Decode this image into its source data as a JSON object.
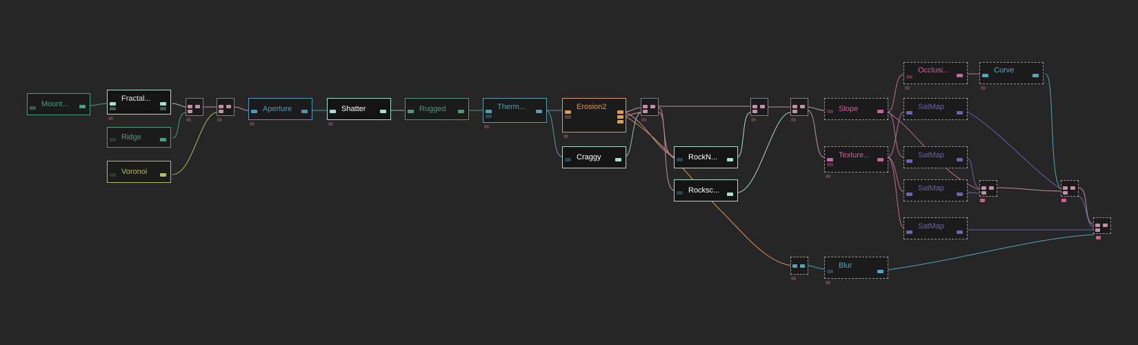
{
  "colors": {
    "background": "#262626",
    "generator": "#4a9d86",
    "fractal": "#a8e0c8",
    "voronoi": "#b7bd5a",
    "aperture": "#4e9ab8",
    "shatter": "#a8e0d0",
    "rugged": "#4a9d76",
    "thermal": "#5a9cb0",
    "erosion": "#e09a5a",
    "rocks": "#a8e0d0",
    "slope": "#d060a0",
    "satmap": "#7060b0",
    "curve": "#50a8c0",
    "blur": "#50a8c0",
    "combiner": "#c490a8"
  },
  "nodes": [
    {
      "id": "mountain",
      "label": "Mount..."
    },
    {
      "id": "fractal",
      "label": "Fractal..."
    },
    {
      "id": "ridge",
      "label": "Ridge"
    },
    {
      "id": "voronoi",
      "label": "Voronoi"
    },
    {
      "id": "aperture",
      "label": "Aperture"
    },
    {
      "id": "shatter",
      "label": "Shatter"
    },
    {
      "id": "rugged",
      "label": "Rugged"
    },
    {
      "id": "thermal",
      "label": "Therm..."
    },
    {
      "id": "erosion2",
      "label": "Erosion2"
    },
    {
      "id": "craggy",
      "label": "Craggy"
    },
    {
      "id": "rocknoise",
      "label": "RockN..."
    },
    {
      "id": "rockscape",
      "label": "Rocksc..."
    },
    {
      "id": "slope",
      "label": "Slope"
    },
    {
      "id": "texturizer",
      "label": "Texture..."
    },
    {
      "id": "occlusion",
      "label": "Occlusi..."
    },
    {
      "id": "curve",
      "label": "Curve"
    },
    {
      "id": "satmap1",
      "label": "SatMap"
    },
    {
      "id": "satmap2",
      "label": "SatMap"
    },
    {
      "id": "satmap3",
      "label": "SatMap"
    },
    {
      "id": "satmap4",
      "label": "SatMap"
    },
    {
      "id": "blur",
      "label": "Blur"
    }
  ]
}
